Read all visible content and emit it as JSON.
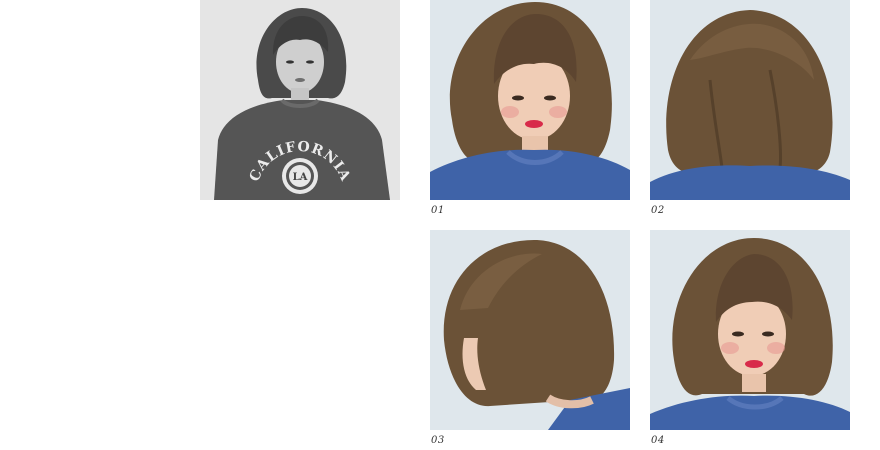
{
  "gallery": {
    "main_photo": {
      "shirt_text": "CALIFORNIA",
      "emblem_text": "LA"
    },
    "photos": [
      {
        "caption": "01",
        "view": "front"
      },
      {
        "caption": "02",
        "view": "back"
      },
      {
        "caption": "03",
        "view": "side"
      },
      {
        "caption": "04",
        "view": "front-angled"
      }
    ]
  },
  "colors": {
    "background": "#ffffff",
    "photo_background": "#dfe7ec",
    "hair": "#6b5237",
    "sweater": "#3f63a8",
    "caption": "#333333"
  }
}
